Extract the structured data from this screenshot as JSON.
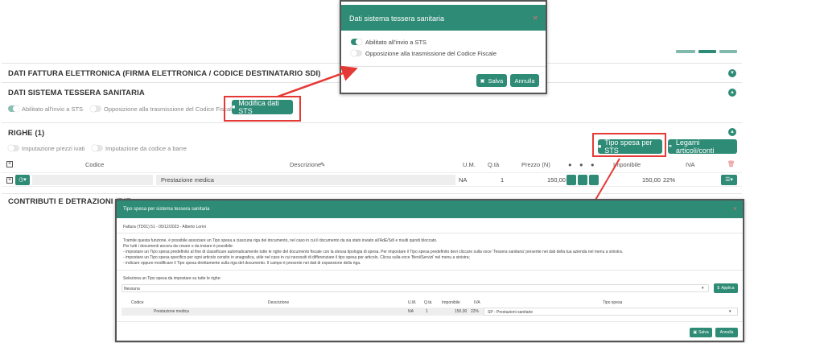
{
  "sections": {
    "fattura_elettronica": "DATI FATTURA ELETTRONICA (FIRMA ELETTRONICA / CODICE DESTINATARIO SDI)",
    "sistema_tessera": "DATI SISTEMA TESSERA SANITARIA",
    "righe": "RIGHE (1)",
    "contributi": "CONTRIBUTI E DETRAZIONI (RIE"
  },
  "sts": {
    "toggle_invio": "Abilitato all'invio a STS",
    "toggle_opposizione": "Opposizione alla trasmissione del Codice Fiscale",
    "modify_button": "Modifica dati STS"
  },
  "righe": {
    "toggle_prezzi_ivati": "Imputazione prezzi ivati",
    "toggle_codice_barre": "Imputazione da codice a barre",
    "tipo_spesa_button": "Tipo spesa per STS",
    "legami_button": "Legami articoli/conti",
    "columns": {
      "codice": "Codice",
      "descrizione": "Descrizione",
      "um": "U.M.",
      "qta": "Q.tà",
      "prezzo": "Prezzo (N)",
      "imponibile": "Imponibile",
      "iva": "IVA"
    },
    "row": {
      "descrizione": "Prestazione medica",
      "um": "NA",
      "qta": "1",
      "prezzo": "150,00",
      "imponibile": "150,00",
      "iva": "22%"
    }
  },
  "popup_sts": {
    "title": "Dati sistema tessera sanitaria",
    "toggle_invio": "Abilitato all'invio a STS",
    "toggle_opposizione": "Opposizione alla trasmissione del Codice Fiscale",
    "save": "Salva",
    "cancel": "Annulla"
  },
  "popup_tipo_spesa": {
    "title": "Tipo spesa per sistema tessera sanitaria",
    "subtitle": "Fattura (TD01) 51 - 05/12/2023 - Alberto Lorini",
    "desc_lines": [
      "Tramite questa funzione, è possibile associare un Tipo spesa a ciascuna riga del documento, nel caso in cui il documento da sia stato inviato all'AdE/SdI e risulti quindi bloccato.",
      "Per tutti i documenti ancora da creare o da inviare è possibile:",
      "- impostare un Tipo spesa predefinito al fine di classificare automaticamente tutte le righe del documento fiscale con la stessa tipologia di spesa. Per impostare il Tipo spesa predefinito devi cliccare sulla voce 'Tessera sanitaria' presente nei dati della tua azienda nel menu a sinistra.",
      "- impostare un Tipo spesa specifico per ogni articolo censito in anagrafica, utile nel caso in cui necessiti di differenziare il tipo spesa per articolo. Clicca sulla voce 'Beni/Servizi' nel menu a sinistra;",
      "- indicare oppure modificare il Tipo spesa direttamente sulla riga del documento. Il campo è presente nei dati di espansione della riga."
    ],
    "select_label": "Seleziona un Tipo spesa da impostare su tutte le righe:",
    "select_value": "Nessuna",
    "apply": "Applica",
    "columns": {
      "codice": "Codice",
      "descrizione": "Descrizione",
      "um": "U.M.",
      "qta": "Q.tà",
      "imponibile": "Imponibile",
      "iva": "IVA",
      "tipo_spesa": "Tipo spesa"
    },
    "row": {
      "descrizione": "Prestazione medica",
      "um": "NA",
      "qta": "1",
      "imponibile": "150,00",
      "iva": "22%",
      "tipo_spesa": "SP - Prestazioni sanitarie"
    },
    "save": "Salva",
    "cancel": "Annulla"
  },
  "colors": {
    "accent": "#2e8b76",
    "highlight": "#e53935"
  }
}
